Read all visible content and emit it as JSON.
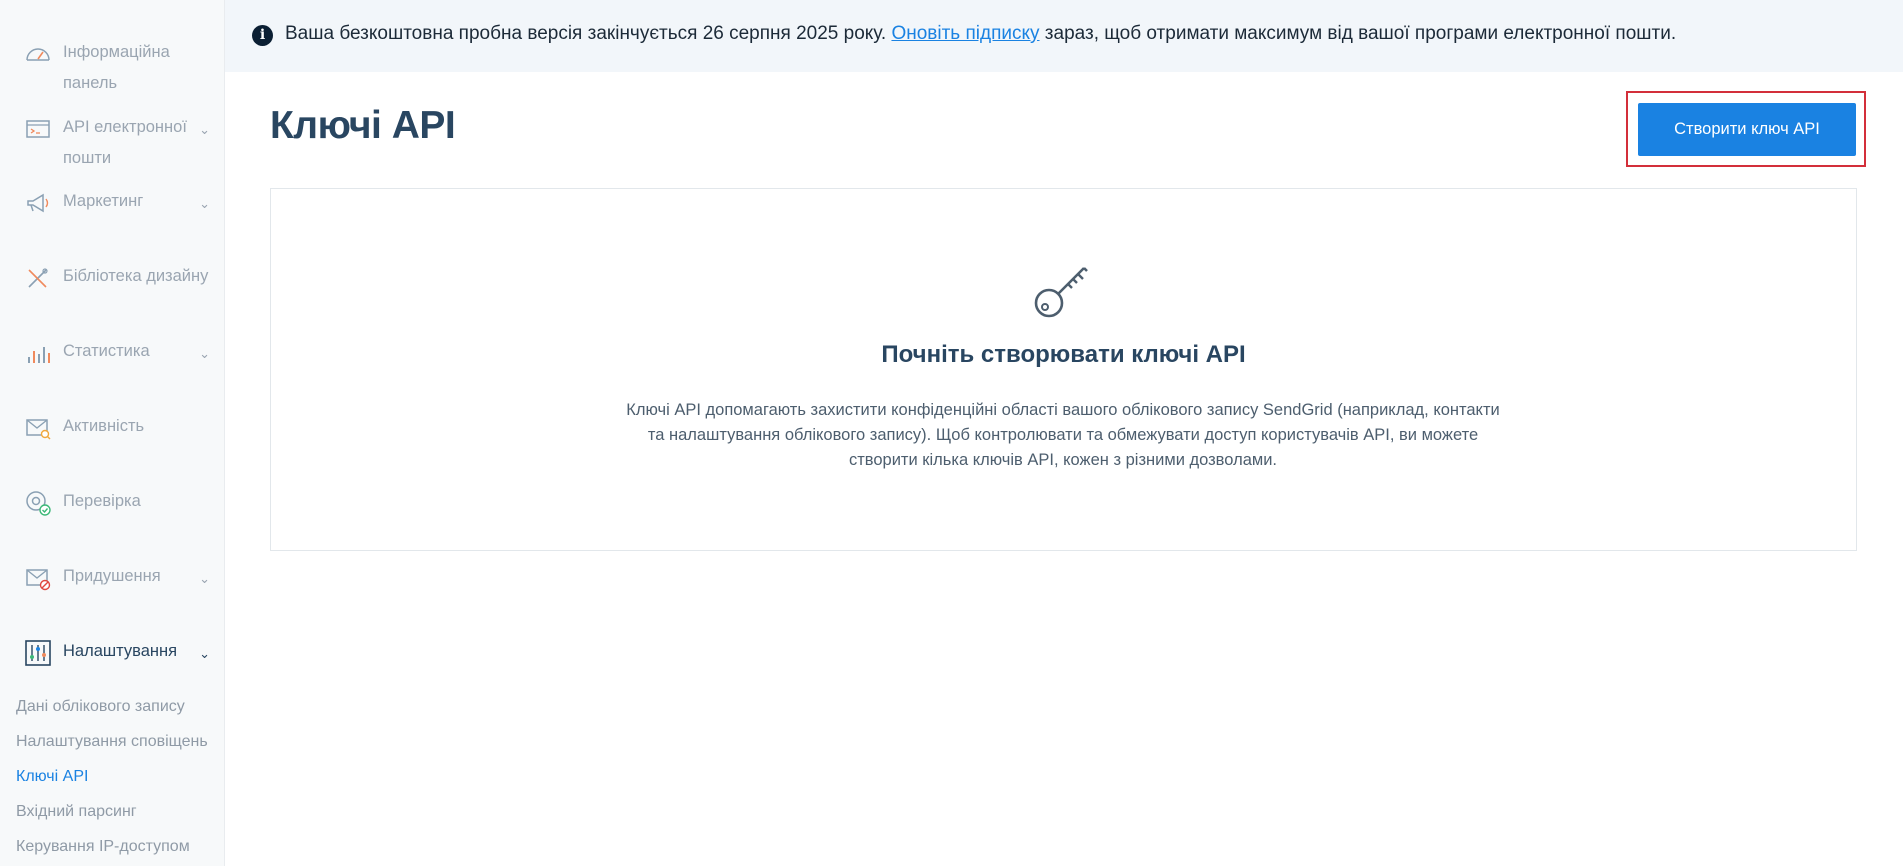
{
  "banner": {
    "text_before": "Ваша безкоштовна пробна версія закінчується 26 серпня 2025 року.",
    "link": "Оновіть підписку",
    "text_after": " зараз, щоб отримати максимум від вашої програми електронної пошти.",
    "icon": "info-icon"
  },
  "sidebar": {
    "items": [
      {
        "label": "Інформаційна панель",
        "icon": "dashboard-gauge-icon"
      },
      {
        "label": "API електронної пошти",
        "icon": "email-api-terminal-icon"
      },
      {
        "label": "Маркетинг",
        "icon": "megaphone-icon"
      },
      {
        "label": "Бібліотека дизайну",
        "icon": "design-tools-icon"
      },
      {
        "label": "Статистика",
        "icon": "bar-chart-icon"
      },
      {
        "label": "Активність",
        "icon": "envelope-search-icon"
      },
      {
        "label": "Перевірка",
        "icon": "at-check-icon"
      },
      {
        "label": "Придушення",
        "icon": "envelope-block-icon"
      },
      {
        "label": "Налаштування",
        "icon": "settings-sliders-icon"
      }
    ],
    "sub_items": [
      {
        "label": "Дані облікового запису"
      },
      {
        "label": "Налаштування сповіщень"
      },
      {
        "label": "Ключі API"
      },
      {
        "label": "Вхідний парсинг"
      },
      {
        "label": "Керування IP-доступом"
      }
    ]
  },
  "main": {
    "title": "Ключі API",
    "create_button": "Створити ключ API",
    "empty_state": {
      "icon": "key-icon",
      "title": "Почніть створювати ключі API",
      "description": "Ключі API допомагають захистити конфіденційні області вашого облікового запису SendGrid (наприклад, контакти та налаштування облікового запису). Щоб контролювати та обмежувати доступ користувачів API, ви можете створити кілька ключів API, кожен з різними дозволами."
    }
  },
  "colors": {
    "accent": "#1a82e2",
    "title": "#294661",
    "highlight_border": "#d32f3a"
  }
}
